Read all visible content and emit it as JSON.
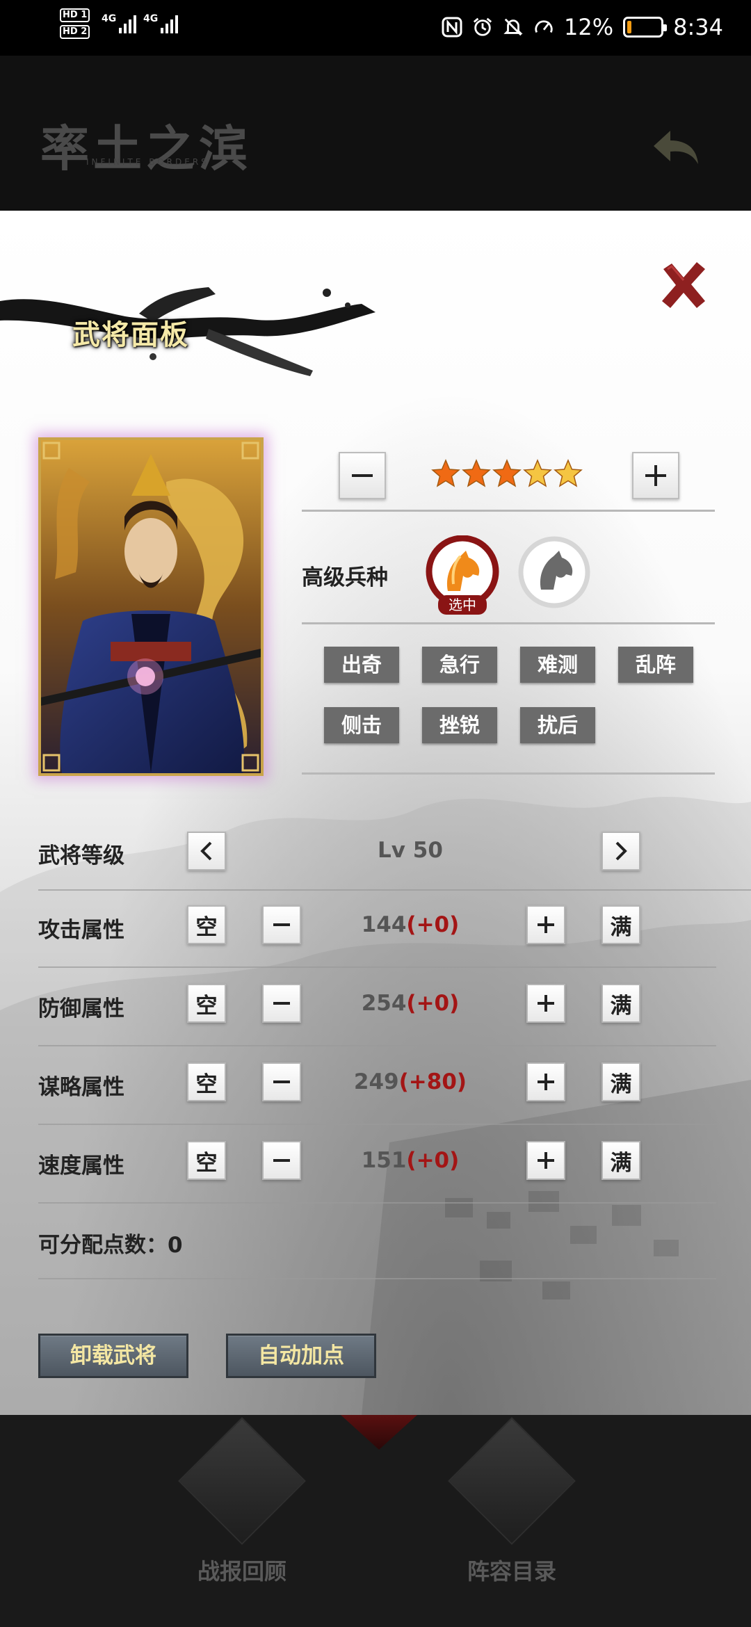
{
  "status_bar": {
    "sim1": "HD 1",
    "sim2": "HD 2",
    "network1": "4G",
    "network2": "4G",
    "battery_percent": "12%",
    "time": "8:34",
    "battery_level": 0.12,
    "battery_color": "#f39c12"
  },
  "app_header": {
    "logo": "率土之滨",
    "logo_subtitle": "INFINITE BORDERS"
  },
  "panel": {
    "title": "武将面板",
    "star_count": 5,
    "star_filled": 3,
    "troop": {
      "label": "高级兵种",
      "selected_badge": "选中"
    },
    "skills": [
      "出奇",
      "急行",
      "难测",
      "乱阵",
      "侧击",
      "挫锐",
      "扰后"
    ],
    "level": {
      "label": "武将等级",
      "value": "Lv 50"
    },
    "stats": [
      {
        "label": "攻击属性",
        "base": "144",
        "bonus": "(+0)"
      },
      {
        "label": "防御属性",
        "base": "254",
        "bonus": "(+0)"
      },
      {
        "label": "谋略属性",
        "base": "249",
        "bonus": "(+80)"
      },
      {
        "label": "速度属性",
        "base": "151",
        "bonus": "(+0)"
      }
    ],
    "stat_empty_label": "空",
    "stat_full_label": "满",
    "points_remaining": "可分配点数：0",
    "unequip_button": "卸载武将",
    "auto_assign_button": "自动加点"
  },
  "bottom_nav": {
    "battle_review": "战报回顾",
    "lineup_catalog": "阵容目录"
  },
  "colors": {
    "accent_red": "#a31515",
    "title_gold": "#f5e9a8",
    "skill_gray": "#6b6b6b"
  }
}
